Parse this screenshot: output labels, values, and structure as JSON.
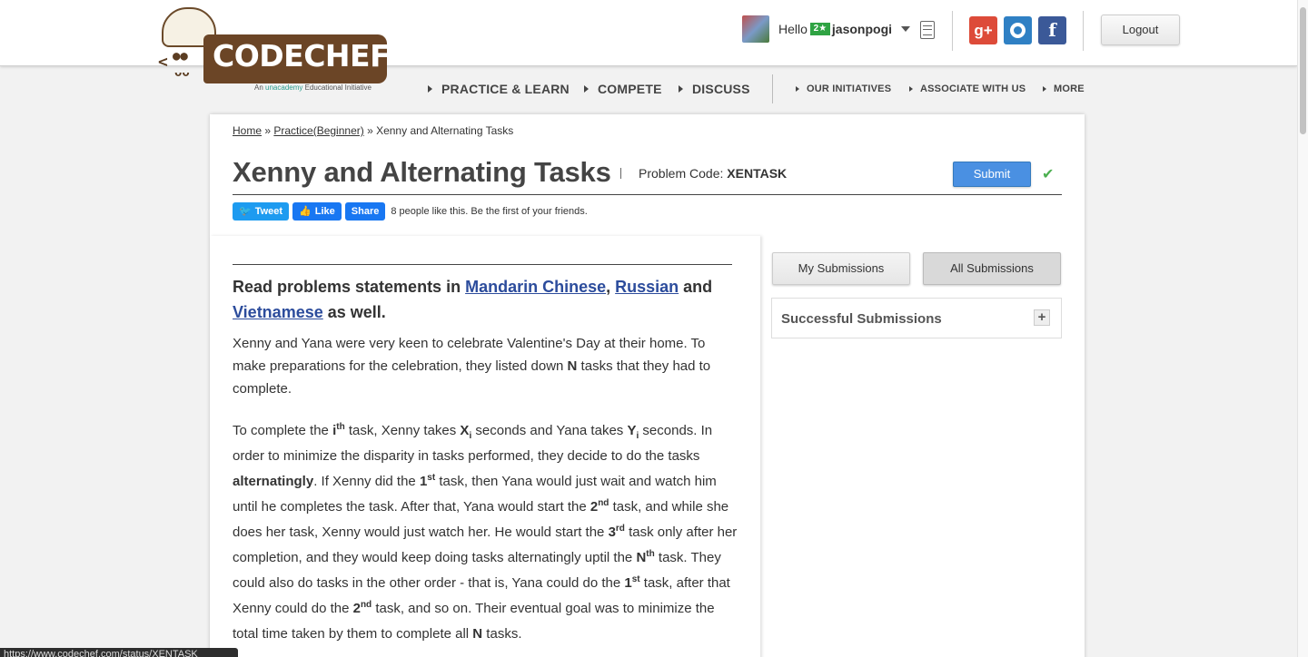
{
  "header": {
    "logo_text": "CODECHEF",
    "logo_tagline_pre": "An",
    "logo_tagline_brand": "unacademy",
    "logo_tagline_post": "Educational Initiative",
    "greeting": "Hello",
    "user_rating_badge": "2★",
    "username": "jasonpogi",
    "logout_label": "Logout",
    "social": {
      "google": "g+",
      "facebook": "f"
    }
  },
  "nav": {
    "main": [
      {
        "label": "PRACTICE & LEARN"
      },
      {
        "label": "COMPETE"
      },
      {
        "label": "DISCUSS"
      }
    ],
    "secondary": [
      {
        "label": "OUR INITIATIVES"
      },
      {
        "label": "ASSOCIATE WITH US"
      },
      {
        "label": "MORE"
      }
    ]
  },
  "breadcrumb": {
    "home": "Home",
    "sep1": " » ",
    "practice": "Practice(Beginner)",
    "sep2": " » ",
    "current": "Xenny and Alternating Tasks"
  },
  "problem": {
    "title": "Xenny and Alternating Tasks",
    "code_label": "Problem Code: ",
    "code": "XENTASK",
    "submit_label": "Submit",
    "solved_mark": "✔"
  },
  "shares": {
    "tweet": "Tweet",
    "like": "Like",
    "share": "Share",
    "like_text": "8 people like this. Be the first of your friends."
  },
  "statement": {
    "read_pre": "Read problems statements in ",
    "lang1": "Mandarin Chinese",
    "comma": ", ",
    "lang2": "Russian",
    "and": " and ",
    "lang3": "Vietnamese",
    "read_post": " as well.",
    "p1_a": "Xenny and Yana were very keen to celebrate Valentine's Day at their home. To make preparations for the celebration, they listed down ",
    "p1_n": "N",
    "p1_b": " tasks that they had to complete."
  },
  "sidebar": {
    "my_submissions": "My Submissions",
    "all_submissions": "All Submissions",
    "successful_submissions": "Successful Submissions",
    "expand": "+"
  },
  "status_url": "https://www.codechef.com/status/XENTASK"
}
